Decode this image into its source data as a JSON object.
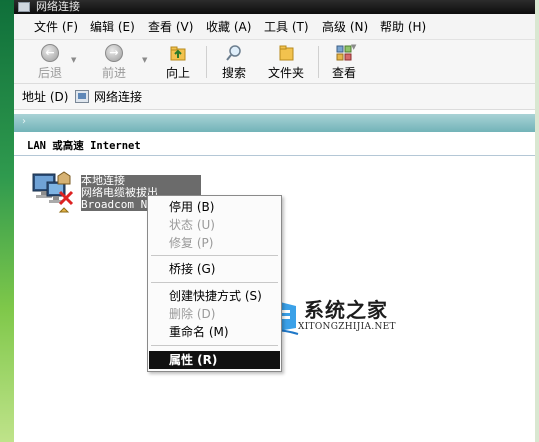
{
  "window": {
    "title": "网络连接"
  },
  "menubar": [
    {
      "label": "文件 (F)"
    },
    {
      "label": "编辑 (E)"
    },
    {
      "label": "查看 (V)"
    },
    {
      "label": "收藏 (A)"
    },
    {
      "label": "工具 (T)"
    },
    {
      "label": "高级 (N)"
    },
    {
      "label": "帮助 (H)"
    }
  ],
  "toolbar": {
    "back": "后退",
    "forward": "前进",
    "up": "向上",
    "search": "搜索",
    "folders": "文件夹",
    "views": "查看"
  },
  "address": {
    "label": "地址 (D)",
    "value": "网络连接"
  },
  "group": {
    "header": "LAN 或高速 Internet"
  },
  "connection": {
    "name": "本地连接",
    "status": "网络电缆被拔出",
    "device": "Broadcom Ne"
  },
  "context_menu": {
    "items": [
      {
        "label": "停用 (B)",
        "enabled": true
      },
      {
        "label": "状态 (U)",
        "enabled": false
      },
      {
        "label": "修复 (P)",
        "enabled": false
      },
      {
        "label": "桥接 (G)",
        "enabled": true
      },
      {
        "label": "创建快捷方式 (S)",
        "enabled": true
      },
      {
        "label": "删除 (D)",
        "enabled": false
      },
      {
        "label": "重命名 (M)",
        "enabled": true
      },
      {
        "label": "属性 (R)",
        "enabled": true,
        "selected": true
      }
    ]
  },
  "watermark": {
    "title": "系统之家",
    "url": "XITONGZHIJIA.NET"
  },
  "colors": {
    "teal_bar": "#72b3b8",
    "selection": "#111111",
    "desktop_green": "#2f9a4e"
  }
}
